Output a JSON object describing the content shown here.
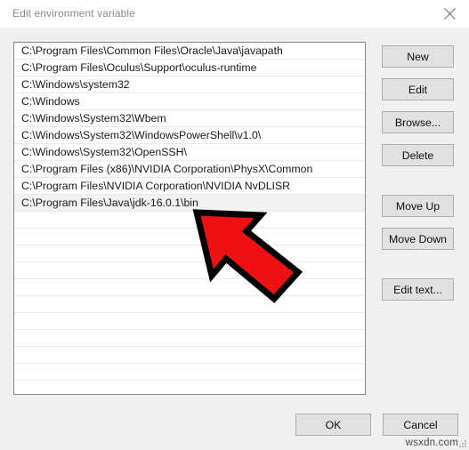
{
  "window": {
    "title": "Edit environment variable",
    "close_icon": "close-icon"
  },
  "list": {
    "selected_index": 9,
    "total_visible_rows": 20,
    "items": [
      "C:\\Program Files\\Common Files\\Oracle\\Java\\javapath",
      "C:\\Program Files\\Oculus\\Support\\oculus-runtime",
      "C:\\Windows\\system32",
      "C:\\Windows",
      "C:\\Windows\\System32\\Wbem",
      "C:\\Windows\\System32\\WindowsPowerShell\\v1.0\\",
      "C:\\Windows\\System32\\OpenSSH\\",
      "C:\\Program Files (x86)\\NVIDIA Corporation\\PhysX\\Common",
      "C:\\Program Files\\NVIDIA Corporation\\NVIDIA NvDLISR",
      "C:\\Program Files\\Java\\jdk-16.0.1\\bin"
    ]
  },
  "side_buttons": {
    "new": "New",
    "edit": "Edit",
    "browse": "Browse...",
    "delete": "Delete",
    "move_up": "Move Up",
    "move_down": "Move Down",
    "edit_text": "Edit text..."
  },
  "bottom_buttons": {
    "ok": "OK",
    "cancel": "Cancel"
  },
  "watermark": {
    "text": "wsxdn.com"
  },
  "annotation": {
    "arrow_color": "#EE1111",
    "arrow_outline": "#000000",
    "points_at": "C:\\Program Files\\Java\\jdk-16.0.1\\bin"
  },
  "colors": {
    "dialog_background": "#f0f0f0",
    "titlebar_background": "#ffffff",
    "listbox_background": "#ffffff",
    "listbox_border": "#828790",
    "row_separator": "#eaeaea",
    "selected_row": "#f2f2f2",
    "button_face": "#e1e1e1",
    "button_border": "#adadad",
    "title_text": "#8a8a8a"
  }
}
